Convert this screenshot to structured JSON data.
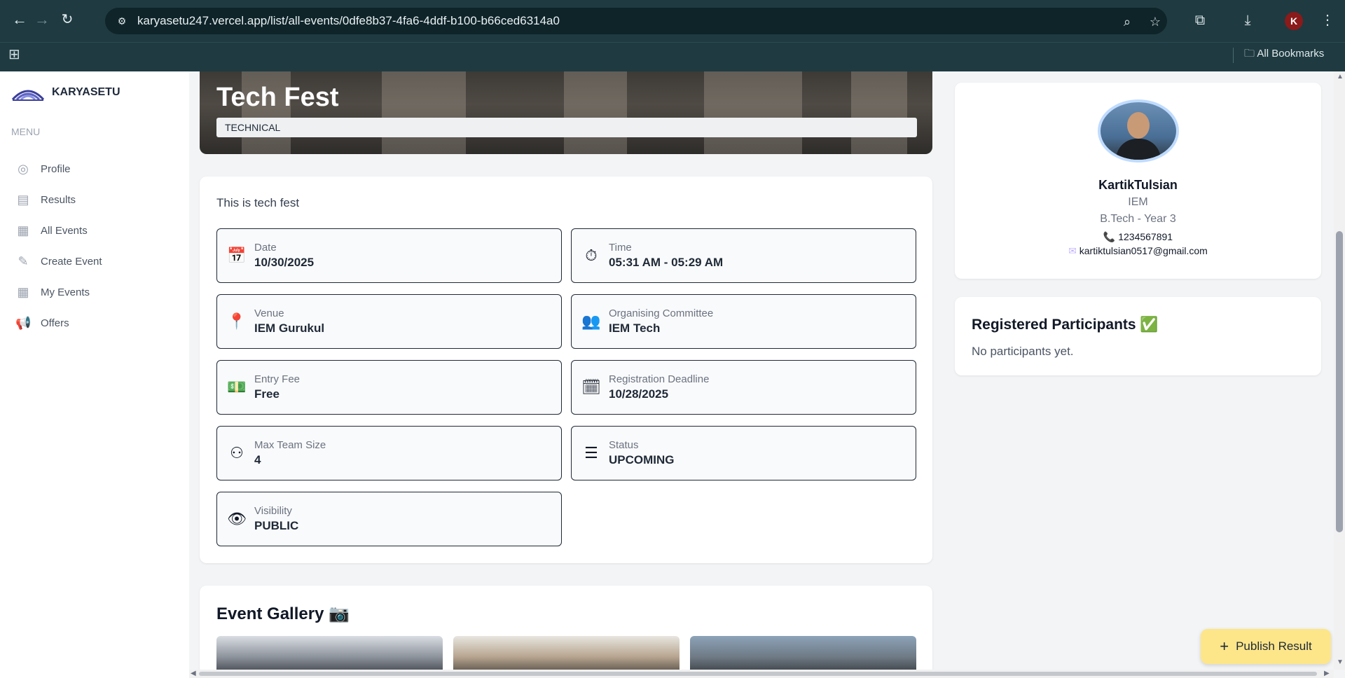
{
  "browser": {
    "url": "karyasetu247.vercel.app/list/all-events/0dfe8b37-4fa6-4ddf-b100-b66ced6314a0",
    "bookmarks_label": "All Bookmarks",
    "profile_initial": "K"
  },
  "sidebar": {
    "brand": "KARYASETU",
    "menu_label": "MENU",
    "items": [
      {
        "label": "Profile",
        "icon": "user-circle-icon"
      },
      {
        "label": "Results",
        "icon": "clipboard-icon"
      },
      {
        "label": "All Events",
        "icon": "calendar-icon"
      },
      {
        "label": "Create Event",
        "icon": "pencil-icon"
      },
      {
        "label": "My Events",
        "icon": "calendar-icon"
      },
      {
        "label": "Offers",
        "icon": "megaphone-icon"
      }
    ]
  },
  "event": {
    "title": "Tech Fest",
    "category": "TECHNICAL",
    "description": "This is tech fest",
    "details": [
      {
        "label": "Date",
        "value": "10/30/2025",
        "icon": "calendar-icon"
      },
      {
        "label": "Time",
        "value": "05:31 AM - 05:29 AM",
        "icon": "stopwatch-icon"
      },
      {
        "label": "Venue",
        "value": "IEM Gurukul",
        "icon": "map-pin-icon"
      },
      {
        "label": "Organising Committee",
        "value": "IEM Tech",
        "icon": "team-icon"
      },
      {
        "label": "Entry Fee",
        "value": "Free",
        "icon": "money-icon"
      },
      {
        "label": "Registration Deadline",
        "value": "10/28/2025",
        "icon": "deadline-calendar-icon"
      },
      {
        "label": "Max Team Size",
        "value": "4",
        "icon": "group-icon"
      },
      {
        "label": "Status",
        "value": "UPCOMING",
        "icon": "status-list-icon"
      },
      {
        "label": "Visibility",
        "value": "PUBLIC",
        "icon": "eye-icon"
      }
    ]
  },
  "gallery": {
    "title": "Event Gallery 📷"
  },
  "organizer": {
    "name": "KartikTulsian",
    "org": "IEM",
    "year": "B.Tech - Year 3",
    "phone": "1234567891",
    "email": "kartiktulsian0517@gmail.com"
  },
  "participants": {
    "title": "Registered Participants ✅",
    "empty_text": "No participants yet."
  },
  "actions": {
    "publish_label": "Publish Result"
  }
}
